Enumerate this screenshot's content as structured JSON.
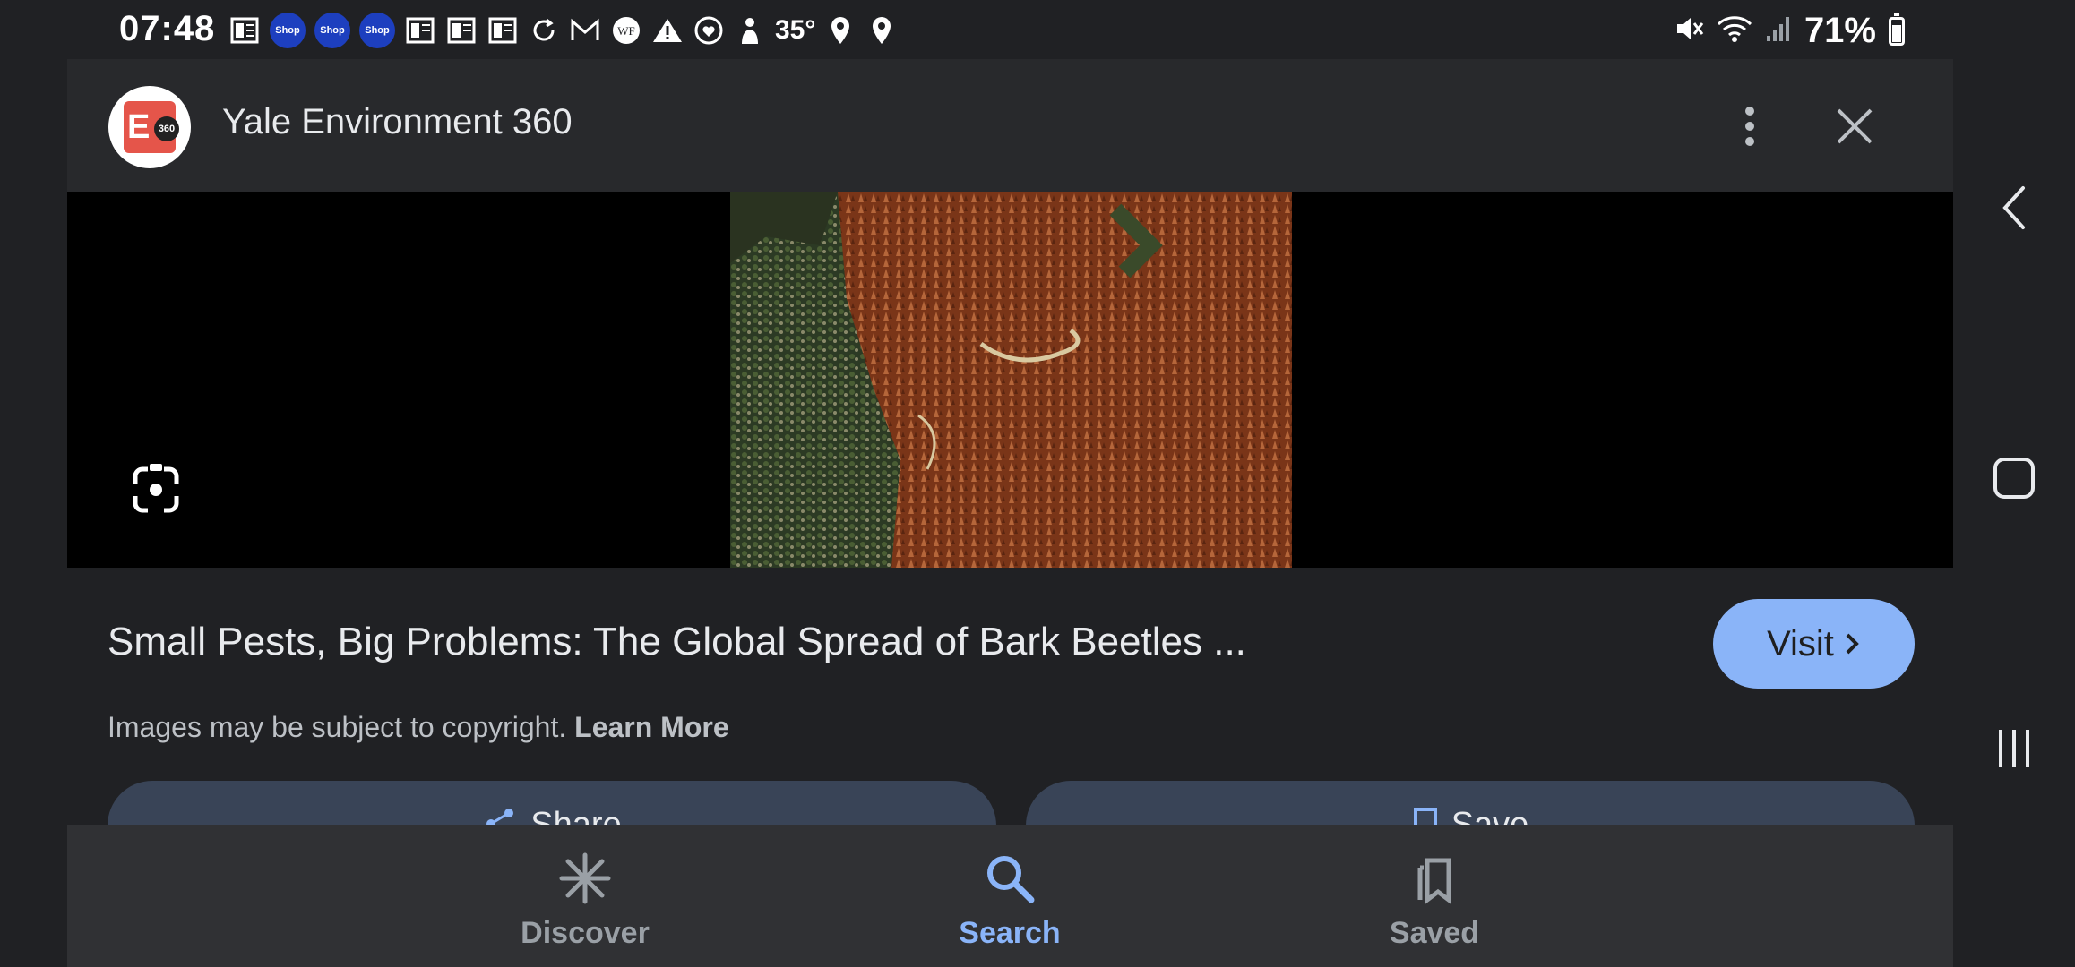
{
  "status_bar": {
    "time": "07:48",
    "shop_badge": "Shop",
    "temperature": "35°",
    "battery": "71%",
    "battery_level": 0.71
  },
  "header": {
    "site_name": "Yale Environment 360",
    "logo_letter": "E",
    "logo_number": "360"
  },
  "result": {
    "title": "Small Pests, Big Problems: The Global Spread of Bark Beetles ...",
    "visit_label": "Visit",
    "copyright_text": "Images may be subject to copyright.",
    "learn_more_label": "Learn More",
    "share_label": "Share",
    "save_label": "Save"
  },
  "bottom_nav": {
    "discover": "Discover",
    "search": "Search",
    "saved": "Saved",
    "active": "search"
  },
  "colors": {
    "accent": "#8ab4f8",
    "background": "#202124",
    "logo_red": "#e5554a"
  }
}
